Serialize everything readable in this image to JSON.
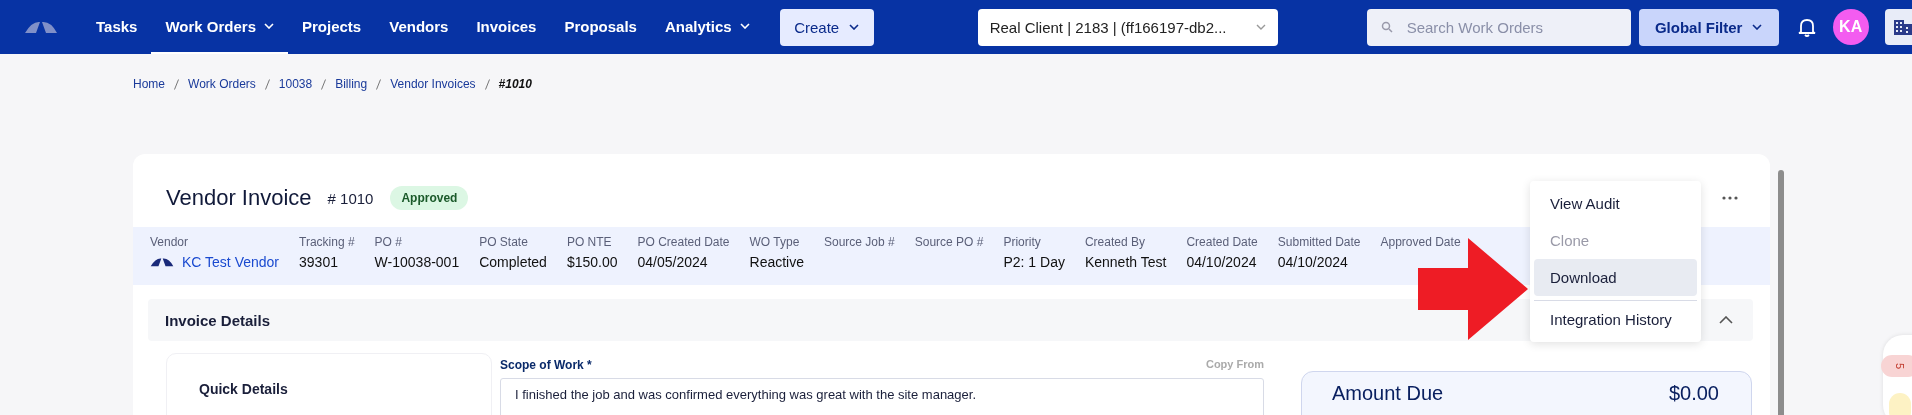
{
  "nav": {
    "items": [
      {
        "label": "Tasks",
        "selected": false,
        "dropdown": false
      },
      {
        "label": "Work Orders",
        "selected": true,
        "dropdown": true
      },
      {
        "label": "Projects",
        "selected": false,
        "dropdown": false
      },
      {
        "label": "Vendors",
        "selected": false,
        "dropdown": false
      },
      {
        "label": "Invoices",
        "selected": false,
        "dropdown": false
      },
      {
        "label": "Proposals",
        "selected": false,
        "dropdown": false
      },
      {
        "label": "Analytics",
        "selected": false,
        "dropdown": true
      }
    ],
    "create_button": "Create",
    "client_select": "Real Client | 2183 | (ff166197-db2...",
    "search": {
      "placeholder": "Search Work Orders"
    },
    "global_filter": "Global Filter",
    "avatar": "KA"
  },
  "breadcrumbs": [
    "Home",
    "Work Orders",
    "10038",
    "Billing",
    "Vendor Invoices",
    "#1010"
  ],
  "invoice": {
    "title": "Vendor Invoice",
    "number": "# 1010",
    "status": "Approved",
    "fields": [
      {
        "label": "Vendor",
        "value": "KC Test Vendor",
        "kind": "vendor"
      },
      {
        "label": "Tracking #",
        "value": "39301",
        "kind": "text"
      },
      {
        "label": "PO #",
        "value": "W-10038-001",
        "kind": "text"
      },
      {
        "label": "PO State",
        "value": "Completed",
        "kind": "text"
      },
      {
        "label": "PO NTE",
        "value": "$150.00",
        "kind": "text"
      },
      {
        "label": "PO Created Date",
        "value": "04/05/2024",
        "kind": "text"
      },
      {
        "label": "WO Type",
        "value": "Reactive",
        "kind": "text"
      },
      {
        "label": "Source Job #",
        "kind": "text"
      },
      {
        "label": "Source PO #",
        "kind": "text"
      },
      {
        "label": "Priority",
        "value": "P2: 1 Day",
        "kind": "text"
      },
      {
        "label": "Created By",
        "value": "Kenneth Test",
        "kind": "text"
      },
      {
        "label": "Created Date",
        "value": "04/10/2024",
        "kind": "text"
      },
      {
        "label": "Submitted Date",
        "value": "04/10/2024",
        "kind": "text"
      },
      {
        "label": "Approved Date",
        "kind": "text"
      }
    ]
  },
  "menu": [
    {
      "label": "View Audit",
      "disabled": false,
      "selected": false,
      "divider_before": false
    },
    {
      "label": "Clone",
      "disabled": true,
      "selected": false,
      "divider_before": false
    },
    {
      "label": "Download",
      "disabled": false,
      "selected": true,
      "divider_before": false
    },
    {
      "label": "Integration History",
      "disabled": false,
      "selected": false,
      "divider_before": true
    }
  ],
  "section": {
    "title": "Invoice Details",
    "expanded": true
  },
  "quick_details": {
    "title": "Quick Details"
  },
  "scope": {
    "label": "Scope of Work *",
    "action": "Copy From",
    "value": "I finished the job and was confirmed everything was great with the site manager."
  },
  "amount": {
    "label": "Amount Due",
    "value": "$0.00"
  },
  "side_badge": "5"
}
